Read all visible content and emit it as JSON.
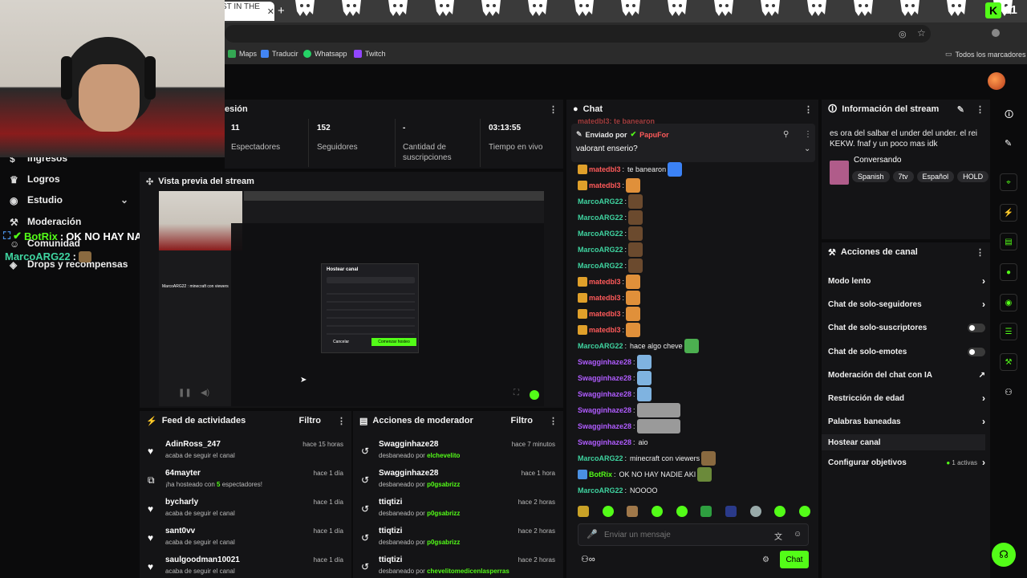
{
  "browser": {
    "tab_title": "ST IN THE I",
    "new_tab": "+",
    "kick_count": "11",
    "bookmarks": [
      "Maps",
      "Traducir",
      "Whatsapp",
      "Twitch"
    ],
    "all_bookmarks": "Todos los marcadores"
  },
  "sidebar": {
    "items": [
      {
        "label": "Ingresos",
        "icon": "dollar-icon"
      },
      {
        "label": "Logros",
        "icon": "trophy-icon"
      },
      {
        "label": "Estudio",
        "icon": "studio-icon"
      },
      {
        "label": "Moderación",
        "icon": "wrench-icon"
      },
      {
        "label": "Comunidad",
        "icon": "community-icon"
      },
      {
        "label": "Drops y recompensas",
        "icon": "drops-icon"
      }
    ],
    "studio_chevron": "⌄"
  },
  "overlay_chat": [
    {
      "user": "BotRix",
      "sep": ":",
      "text": "OK NO HAY NADIE AKI"
    },
    {
      "user": "MarcoARG22",
      "sep": ":",
      "text": ""
    }
  ],
  "session": {
    "title": "esión",
    "stats": [
      {
        "value": "11",
        "label": "Espectadores"
      },
      {
        "value": "152",
        "label": "Seguidores"
      },
      {
        "value": "-",
        "label": "Cantidad de suscripciones"
      },
      {
        "value": "03:13:55",
        "label": "Tiempo en vivo"
      }
    ]
  },
  "preview": {
    "title": "Vista previa del stream",
    "modal_title": "Hostear canal",
    "modal_cancel": "Cancelar",
    "modal_confirm": "Comenzar hosteo",
    "chat_line": "MarcoARG22 : minecraft con viewers"
  },
  "feed": {
    "title": "Feed de actividades",
    "filter": "Filtro",
    "items": [
      {
        "name": "AdinRoss_247",
        "sub": "acaba de seguir el canal",
        "time": "hace 15 horas",
        "icon": "heart-icon"
      },
      {
        "name": "64mayter",
        "sub_pre": "¡ha hosteado con ",
        "sub_num": "5",
        "sub_post": " espectadores!",
        "time": "hace 1 día",
        "icon": "host-icon"
      },
      {
        "name": "bycharly",
        "sub": "acaba de seguir el canal",
        "time": "hace 1 día",
        "icon": "heart-icon"
      },
      {
        "name": "sant0vv",
        "sub": "acaba de seguir el canal",
        "time": "hace 1 día",
        "icon": "heart-icon"
      },
      {
        "name": "saulgoodman10021",
        "sub": "acaba de seguir el canal",
        "time": "hace 1 día",
        "icon": "heart-icon"
      }
    ]
  },
  "modactions": {
    "title": "Acciones de moderador",
    "filter": "Filtro",
    "items": [
      {
        "name": "Swagginhaze28",
        "pre": "desbaneado por ",
        "by": "elchevelito",
        "time": "hace 7 minutos"
      },
      {
        "name": "Swagginhaze28",
        "pre": "desbaneado por ",
        "by": "p0gsabrizz",
        "time": "hace 1 hora"
      },
      {
        "name": "ttiqtizi",
        "pre": "desbaneado por ",
        "by": "p0gsabrizz",
        "time": "hace 2 horas"
      },
      {
        "name": "ttiqtizi",
        "pre": "desbaneado por ",
        "by": "p0gsabrizz",
        "time": "hace 2 horas"
      },
      {
        "name": "ttiqtizi",
        "pre": "desbaneado por ",
        "by": "chevelitomedicenlasperras",
        "time": "hace 2 horas"
      }
    ]
  },
  "chat": {
    "title": "Chat",
    "pinned_sender_pre": "Enviado por",
    "pinned_sender": "PapuFor",
    "pinned_text": "valorant enserio?",
    "top_partial": "matedbl3: te banearon",
    "messages": [
      {
        "user": "matedbl3",
        "color": "#ff5a5a",
        "text": "te banearon",
        "badge": true,
        "emotes": [
          "#3b82f6"
        ]
      },
      {
        "user": "matedbl3",
        "color": "#ff5a5a",
        "text": "",
        "badge": true,
        "emotes": [
          "#e0903a"
        ]
      },
      {
        "user": "MarcoARG22",
        "color": "#3fd4a0",
        "text": "",
        "badge": false,
        "emotes": [
          "#6b4a2e"
        ]
      },
      {
        "user": "MarcoARG22",
        "color": "#3fd4a0",
        "text": "",
        "badge": false,
        "emotes": [
          "#6b4a2e"
        ]
      },
      {
        "user": "MarcoARG22",
        "color": "#3fd4a0",
        "text": "",
        "badge": false,
        "emotes": [
          "#6b4a2e"
        ]
      },
      {
        "user": "MarcoARG22",
        "color": "#3fd4a0",
        "text": "",
        "badge": false,
        "emotes": [
          "#6b4a2e"
        ]
      },
      {
        "user": "MarcoARG22",
        "color": "#3fd4a0",
        "text": "",
        "badge": false,
        "emotes": [
          "#6b4a2e"
        ]
      },
      {
        "user": "matedbl3",
        "color": "#ff5a5a",
        "text": "",
        "badge": true,
        "emotes": [
          "#e0903a"
        ]
      },
      {
        "user": "matedbl3",
        "color": "#ff5a5a",
        "text": "",
        "badge": true,
        "emotes": [
          "#e0903a"
        ]
      },
      {
        "user": "matedbl3",
        "color": "#ff5a5a",
        "text": "",
        "badge": true,
        "emotes": [
          "#e0903a"
        ]
      },
      {
        "user": "matedbl3",
        "color": "#ff5a5a",
        "text": "",
        "badge": true,
        "emotes": [
          "#e0903a"
        ]
      },
      {
        "user": "MarcoARG22",
        "color": "#3fd4a0",
        "text": "hace algo cheve",
        "badge": false,
        "emotes": [
          "#4caf50"
        ]
      },
      {
        "user": "Swagginhaze28",
        "color": "#b05cff",
        "text": "",
        "badge": false,
        "emotes": [
          "#7fb3e0"
        ]
      },
      {
        "user": "Swagginhaze28",
        "color": "#b05cff",
        "text": "",
        "badge": false,
        "emotes": [
          "#7fb3e0"
        ]
      },
      {
        "user": "Swagginhaze28",
        "color": "#b05cff",
        "text": "",
        "badge": false,
        "emotes": [
          "#7fb3e0"
        ]
      },
      {
        "user": "Swagginhaze28",
        "color": "#b05cff",
        "text": "",
        "badge": false,
        "emotes": [
          "#9a9a9a"
        ]
      },
      {
        "user": "Swagginhaze28",
        "color": "#b05cff",
        "text": "",
        "badge": false,
        "emotes": [
          "#9a9a9a"
        ]
      },
      {
        "user": "Swagginhaze28",
        "color": "#b05cff",
        "text": "aio",
        "badge": false,
        "emotes": []
      },
      {
        "user": "MarcoARG22",
        "color": "#3fd4a0",
        "text": "minecraft con viewers",
        "badge": false,
        "emotes": [
          "#8a6a40"
        ]
      },
      {
        "user": "BotRix",
        "color": "#53fc18",
        "text": "OK NO HAY NADIE AKI",
        "badge": true,
        "emotes": [
          "#6b8a3a"
        ]
      },
      {
        "user": "MarcoARG22",
        "color": "#3fd4a0",
        "text": "NOOOO",
        "badge": false,
        "emotes": []
      }
    ],
    "input_placeholder": "Enviar un mensaje",
    "send_label": "Chat"
  },
  "stream_info": {
    "title": "Información del stream",
    "description": "es ora del salbar el under del under. el rei KEKW. fnaf y un poco mas idk",
    "category": "Conversando",
    "tags": [
      "Spanish",
      "7tv",
      "Español",
      "HOLD"
    ]
  },
  "channel_actions": {
    "title": "Acciones de canal",
    "items": [
      {
        "label": "Modo lento",
        "control": "chevron"
      },
      {
        "label": "Chat de solo-seguidores",
        "control": "chevron"
      },
      {
        "label": "Chat de solo-suscriptores",
        "control": "toggle"
      },
      {
        "label": "Chat de solo-emotes",
        "control": "toggle"
      },
      {
        "label": "Moderación del chat con IA",
        "control": "external"
      },
      {
        "label": "Restricción de edad",
        "control": "chevron"
      },
      {
        "label": "Palabras baneadas",
        "control": "chevron"
      },
      {
        "label": "Hostear canal",
        "control": "none"
      },
      {
        "label": "Configurar objetivos",
        "control": "chevron"
      }
    ],
    "goals_active": "1 activas"
  },
  "colors": {
    "accent": "#53fc18",
    "panel": "#141416",
    "bg": "#0b0b0c"
  }
}
